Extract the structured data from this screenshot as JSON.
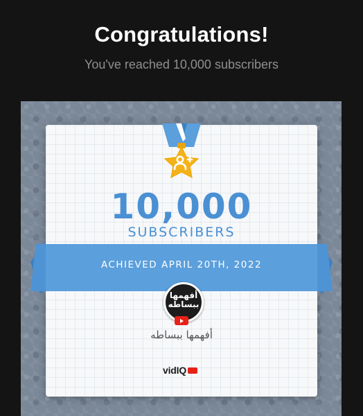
{
  "header": {
    "title": "Congratulations!",
    "subtitle": "You've reached 10,000 subscribers"
  },
  "milestone": {
    "count": "10,000",
    "unit_label": "SUBSCRIBERS",
    "achieved_text": "ACHIEVED APRIL 20TH, 2022"
  },
  "channel": {
    "avatar_line1": "أفهمها",
    "avatar_line2": "ببساطه",
    "name": "أفهمها ببساطه"
  },
  "branding": {
    "logo_text": "vidIQ"
  },
  "colors": {
    "page_bg": "#141414",
    "accent_blue": "#4a90d3",
    "ribbon_blue": "#5b9fdc",
    "star_gold": "#f4b21a",
    "youtube_red": "#e62117"
  },
  "icons": [
    "medal-star-icon",
    "add-user-icon",
    "youtube-play-icon"
  ]
}
